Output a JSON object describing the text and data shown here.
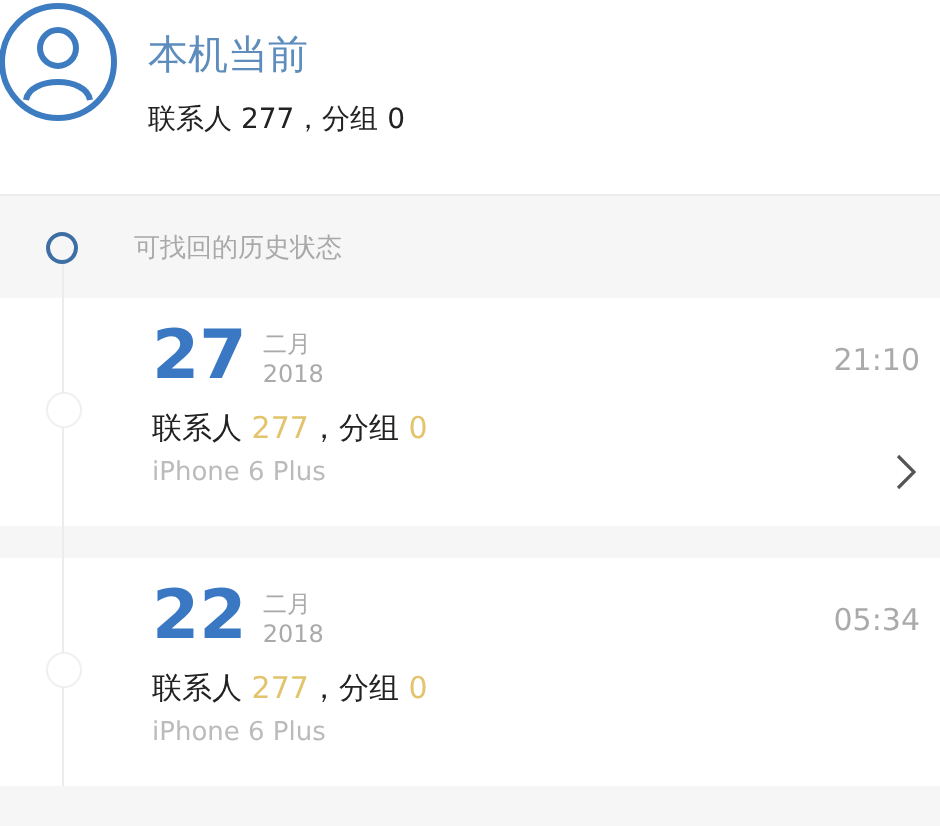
{
  "current": {
    "title": "本机当前",
    "summary": "联系人 277，分组 0"
  },
  "history": {
    "heading": "可找回的历史状态"
  },
  "snapshots": [
    {
      "day": "27",
      "month": "二月",
      "year": "2018",
      "time": "21:10",
      "contacts_label": "联系人",
      "contacts": "277",
      "groups_label": "，分组",
      "groups": "0",
      "device": "iPhone 6 Plus",
      "chevron": true
    },
    {
      "day": "22",
      "month": "二月",
      "year": "2018",
      "time": "05:34",
      "contacts_label": "联系人",
      "contacts": "277",
      "groups_label": "，分组",
      "groups": "0",
      "device": "iPhone 6 Plus",
      "chevron": false
    }
  ]
}
